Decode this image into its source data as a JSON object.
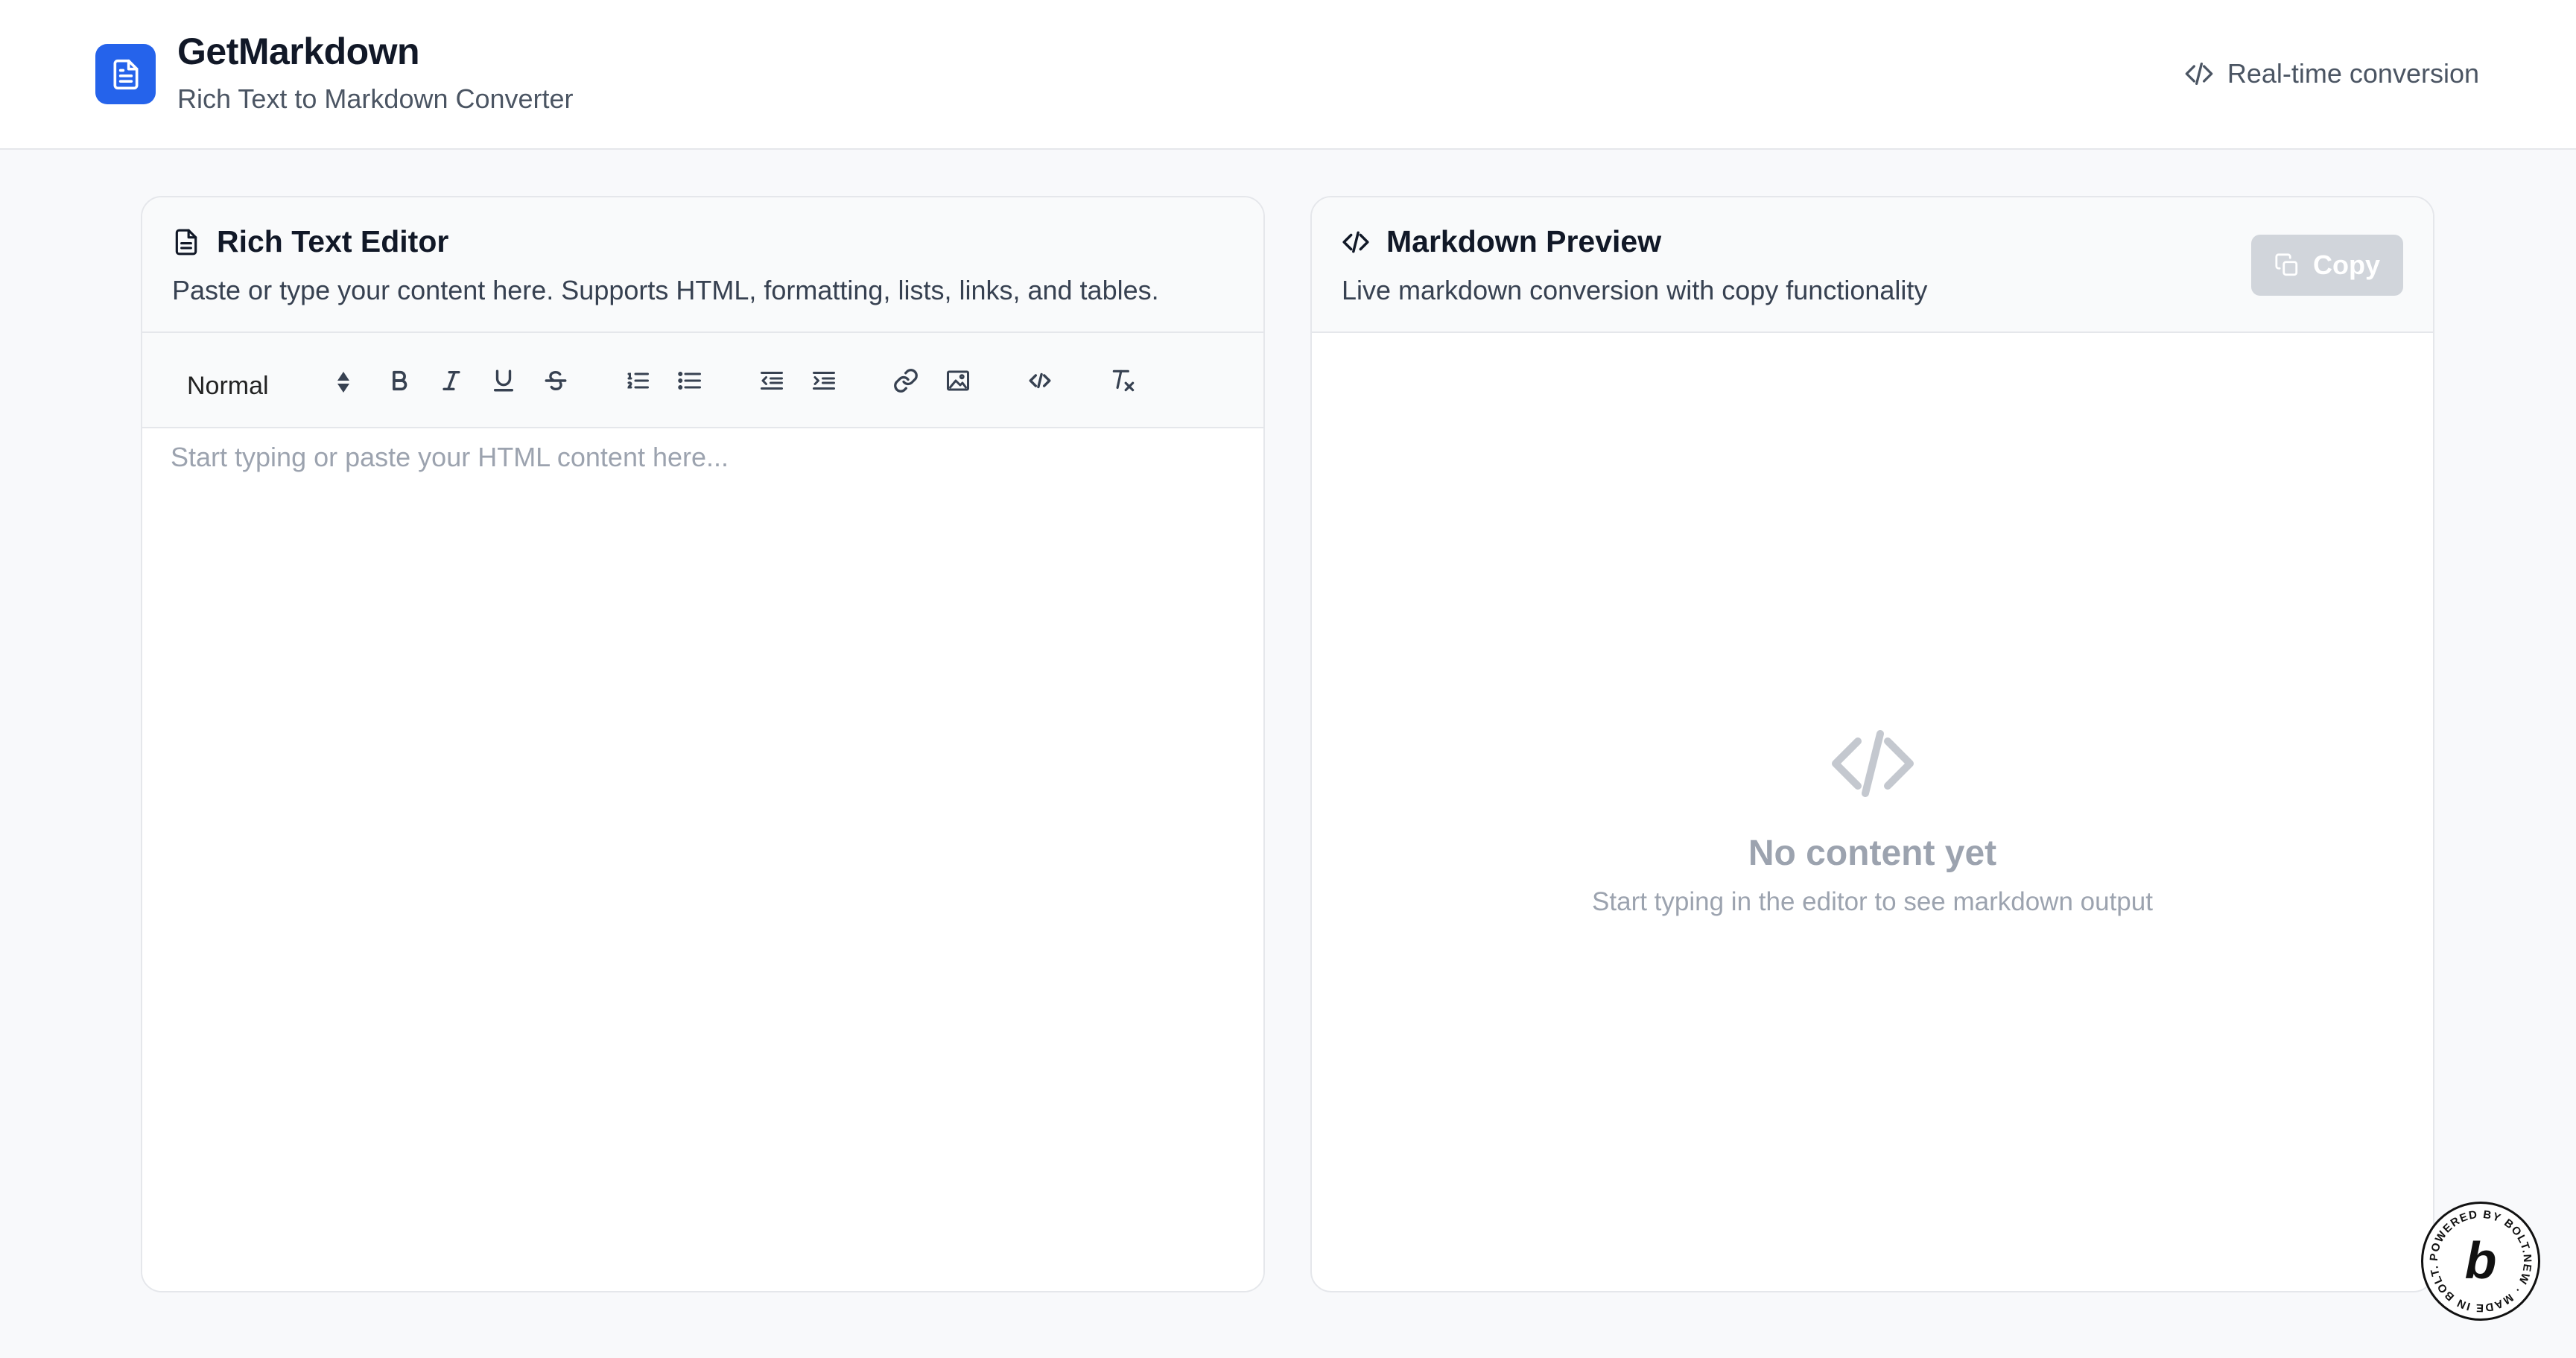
{
  "header": {
    "title": "GetMarkdown",
    "subtitle": "Rich Text to Markdown Converter",
    "status_label": "Real-time conversion",
    "logo_icon": "document-icon",
    "accent": "#2563eb"
  },
  "editor": {
    "title": "Rich Text Editor",
    "description": "Paste or type your content here. Supports HTML, formatting, lists, links, and tables.",
    "format_select": "Normal",
    "toolbar": [
      {
        "name": "bold-button",
        "icon": "B"
      },
      {
        "name": "italic-button",
        "icon": "I"
      },
      {
        "name": "underline-button",
        "icon": "U"
      },
      {
        "name": "strike-button",
        "icon": "S"
      },
      {
        "name": "ordered-list-button",
        "icon": "ordered-list-icon"
      },
      {
        "name": "bullet-list-button",
        "icon": "bullet-list-icon"
      },
      {
        "name": "outdent-button",
        "icon": "outdent-icon"
      },
      {
        "name": "indent-button",
        "icon": "indent-icon"
      },
      {
        "name": "link-button",
        "icon": "link-icon"
      },
      {
        "name": "image-button",
        "icon": "image-icon"
      },
      {
        "name": "code-button",
        "icon": "code-icon"
      },
      {
        "name": "clear-format-button",
        "icon": "clear-format-icon"
      }
    ],
    "placeholder": "Start typing or paste your HTML content here..."
  },
  "preview": {
    "title": "Markdown Preview",
    "description": "Live markdown conversion with copy functionality",
    "copy_label": "Copy",
    "empty_title": "No content yet",
    "empty_subtitle": "Start typing in the editor to see markdown output"
  },
  "badge": {
    "text": "POWERED BY BOLT.NEW · MADE IN BOLT.NEW",
    "letter": "b"
  }
}
